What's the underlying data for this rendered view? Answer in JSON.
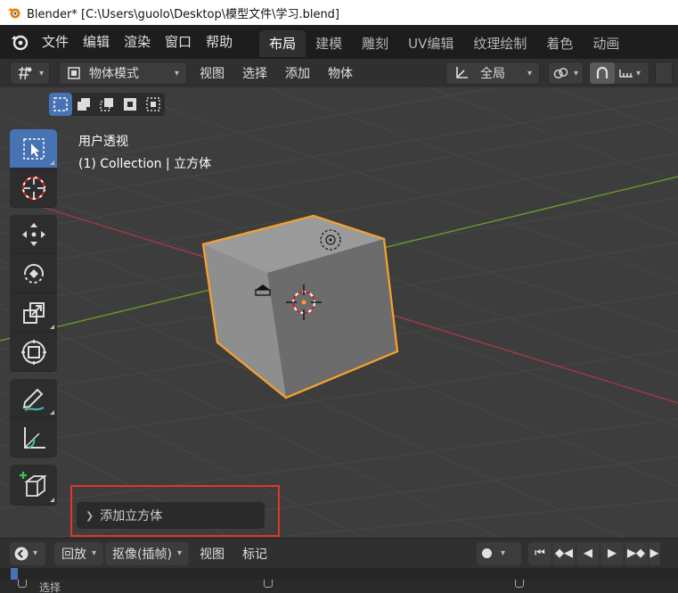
{
  "window": {
    "title": "Blender* [C:\\Users\\guolo\\Desktop\\模型文件\\学习.blend]"
  },
  "menubar": {
    "menus": [
      "文件",
      "编辑",
      "渲染",
      "窗口",
      "帮助"
    ],
    "workspaces": [
      "布局",
      "建模",
      "雕刻",
      "UV编辑",
      "纹理绘制",
      "着色",
      "动画"
    ],
    "active_workspace": "布局"
  },
  "header": {
    "mode": "物体模式",
    "menus": [
      "视图",
      "选择",
      "添加",
      "物体"
    ],
    "transform_orientation": "全局"
  },
  "viewport": {
    "view_name": "用户透视",
    "collection_info": "(1) Collection | 立方体"
  },
  "toolbar": {
    "tools": [
      "select-box",
      "cursor",
      "move",
      "rotate",
      "scale",
      "transform",
      "annotate",
      "measure",
      "add-cube"
    ],
    "active_tool": "select-box"
  },
  "redo_panel": {
    "label": "添加立方体"
  },
  "timeline": {
    "playback": "回放",
    "keying": "抠像(插帧)",
    "menus": [
      "视图",
      "标记"
    ]
  },
  "statusbar": {
    "left_label": "选择"
  },
  "colors": {
    "accent": "#4772b3",
    "selection_outline": "#f5a030",
    "x_axis": "#a33a45",
    "y_axis": "#6d9a2c",
    "highlight_box": "#e2342c"
  }
}
